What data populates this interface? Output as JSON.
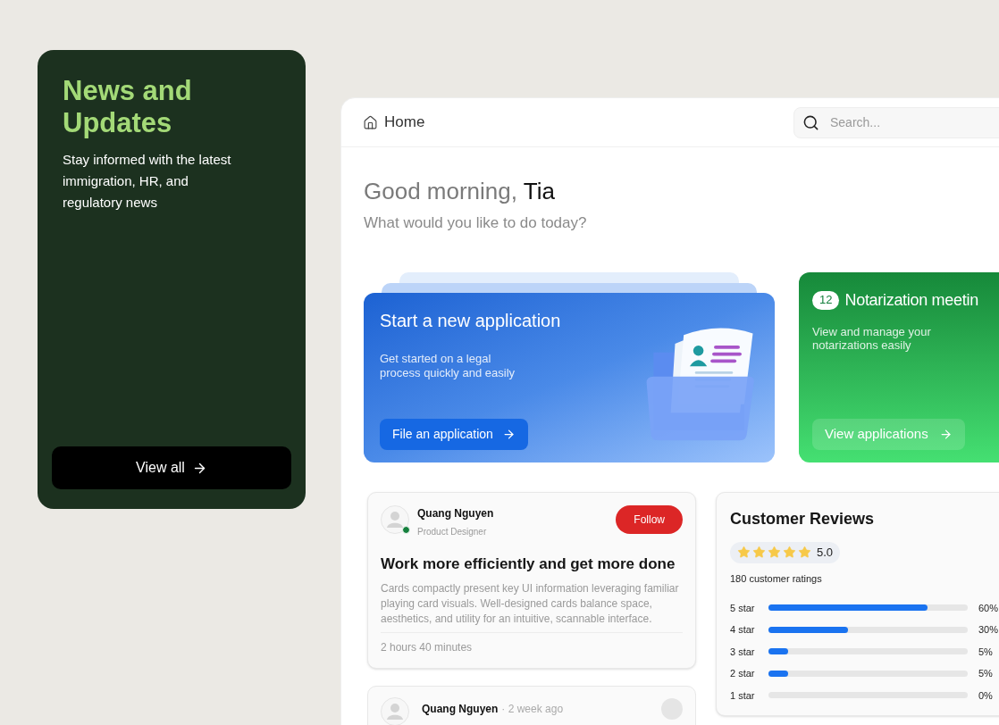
{
  "news_panel": {
    "title": "News and Updates",
    "description": "Stay informed with the latest immigration, HR, and regulatory news",
    "button": "View all"
  },
  "header": {
    "breadcrumb": "Home",
    "search": {
      "placeholder": "Search..."
    }
  },
  "greeting": {
    "text": "Good morning,",
    "name": "Tia",
    "subtitle": "What would you like to do today?"
  },
  "action_cards": [
    {
      "kind": "illustrated",
      "title": "Start a new application",
      "description": "Get started on a legal process quickly and easily",
      "button": "File an application"
    },
    {
      "kind": "counter",
      "badge": "12",
      "title": "Notarization meetin",
      "description": "View and manage your notarizations easily",
      "button": "View applications"
    }
  ],
  "posts": [
    {
      "kind": "full",
      "author": "Quang Nguyen",
      "role": "Product Designer",
      "online": true,
      "follow_button": "Follow",
      "title": "Work more efficiently and get more done",
      "body": "Cards compactly present key UI information leveraging familiar playing card visuals. Well-designed cards balance space, aesthetics, and utility for an intuitive, scannable interface.",
      "time": "2 hours 40 minutes"
    },
    {
      "kind": "compact",
      "author": "Quang Nguyen",
      "online": false,
      "meta": "· 2 week ago"
    }
  ],
  "reviews": {
    "title": "Customer Reviews",
    "stars": 5,
    "score": "5.0",
    "count": "180 customer ratings",
    "breakdown": [
      {
        "label": "5 star",
        "level": 0.8,
        "percent": "60%"
      },
      {
        "label": "4 star",
        "level": 0.4,
        "percent": "30%"
      },
      {
        "label": "3 star",
        "level": 0.1,
        "percent": "5%"
      },
      {
        "label": "2 star",
        "level": 0.1,
        "percent": "5%"
      },
      {
        "label": "1 star",
        "percent": "0%"
      }
    ]
  }
}
